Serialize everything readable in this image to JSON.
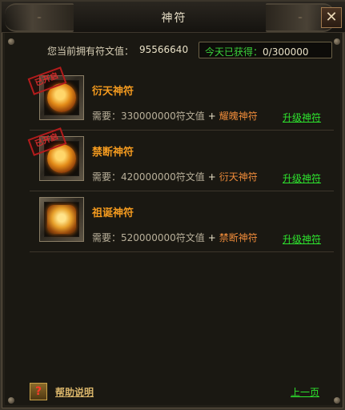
{
  "window": {
    "title": "神符",
    "close": "✕"
  },
  "info": {
    "fuwen_label": "您当前拥有符文值：",
    "fuwen_value": "95566640",
    "today_label": "今天已获得：",
    "today_value": "0/300000"
  },
  "runes": [
    {
      "name": "衍天神符",
      "activated": true,
      "stamp": "已开启",
      "need_label": "需要：",
      "need_value": "330000000符文值",
      "plus": "+",
      "prev": "耀魄神符",
      "upgrade": "升级神符"
    },
    {
      "name": "禁断神符",
      "activated": true,
      "stamp": "已开启",
      "need_label": "需要：",
      "need_value": "420000000符文值",
      "plus": "+",
      "prev": "衍天神符",
      "upgrade": "升级神符"
    },
    {
      "name": "祖诞神符",
      "activated": false,
      "stamp": "",
      "need_label": "需要：",
      "need_value": "520000000符文值",
      "plus": "+",
      "prev": "禁断神符",
      "upgrade": "升级神符"
    }
  ],
  "footer": {
    "help_icon": "?",
    "help_label": "帮助说明",
    "prev_page": "上一页"
  },
  "colors": {
    "accent_orange": "#f39a1f",
    "link_green": "#2ee52e",
    "stamp_red": "#d42a2a"
  }
}
